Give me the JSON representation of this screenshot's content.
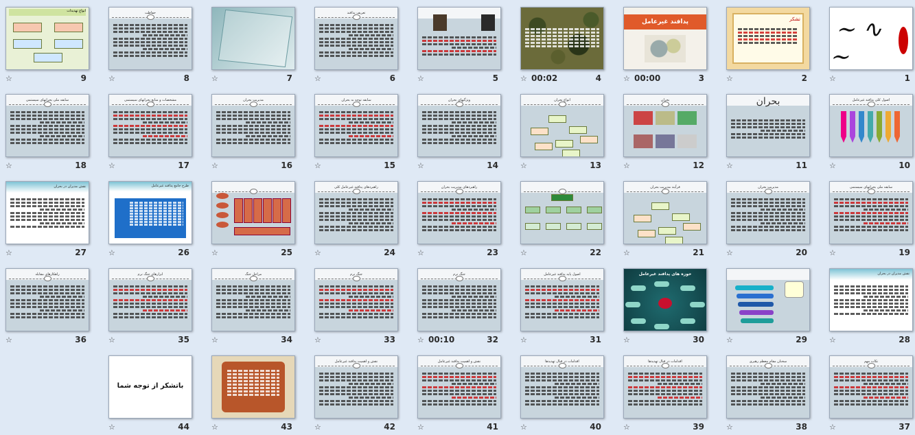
{
  "slides": [
    {
      "number": "1",
      "timing": "",
      "style": "calligraphy",
      "title": ""
    },
    {
      "number": "2",
      "timing": "",
      "style": "certificate",
      "title": "تشکر"
    },
    {
      "number": "3",
      "timing": "00:00",
      "style": "orange-title",
      "title": "پدافند غیرعامل"
    },
    {
      "number": "4",
      "timing": "00:02",
      "style": "camo",
      "title": ""
    },
    {
      "number": "5",
      "timing": "",
      "style": "portraits",
      "title": ""
    },
    {
      "number": "6",
      "timing": "",
      "style": "gray-text",
      "title": "تعریف پدافند"
    },
    {
      "number": "7",
      "timing": "",
      "style": "teal-glass",
      "title": ""
    },
    {
      "number": "8",
      "timing": "",
      "style": "gray-text",
      "title": "حفاظت"
    },
    {
      "number": "9",
      "timing": "",
      "style": "boxes",
      "title": "انواع تهدیدات"
    },
    {
      "number": "10",
      "timing": "",
      "style": "arrows",
      "title": "اصول کلی پدافند غیرعامل"
    },
    {
      "number": "11",
      "timing": "",
      "style": "bohran",
      "title": "بحران"
    },
    {
      "number": "12",
      "timing": "",
      "style": "photos",
      "title": "بحران"
    },
    {
      "number": "13",
      "timing": "",
      "style": "diagram",
      "title": "انواع بحران"
    },
    {
      "number": "14",
      "timing": "",
      "style": "gray-text",
      "title": "ویژگیهای بحران"
    },
    {
      "number": "15",
      "timing": "",
      "style": "gray-text",
      "title": "سابقه توجه به بحران"
    },
    {
      "number": "16",
      "timing": "",
      "style": "gray-text",
      "title": "مدیریت بحران"
    },
    {
      "number": "17",
      "timing": "",
      "style": "gray-text",
      "title": "مشخصات و منابع بحرانهای سیستمی"
    },
    {
      "number": "18",
      "timing": "",
      "style": "gray-text",
      "title": "سابقه ملی بحرانهای سیستمی"
    },
    {
      "number": "19",
      "timing": "",
      "style": "gray-text",
      "title": "سابقه ملی بحرانهای سیستمی"
    },
    {
      "number": "20",
      "timing": "",
      "style": "gray-text",
      "title": "مدیریت بحران"
    },
    {
      "number": "21",
      "timing": "",
      "style": "diagram",
      "title": "فرآیند مدیریت بحران"
    },
    {
      "number": "22",
      "timing": "",
      "style": "orgchart",
      "title": ""
    },
    {
      "number": "23",
      "timing": "",
      "style": "gray-text",
      "title": "راهبردهای مدیریت بحران"
    },
    {
      "number": "24",
      "timing": "",
      "style": "gray-text",
      "title": "راهبردهای پدافند غیرعامل کلی"
    },
    {
      "number": "25",
      "timing": "",
      "style": "flow",
      "title": ""
    },
    {
      "number": "26",
      "timing": "",
      "style": "blue-list",
      "title": "طرح جامع پدافند غیرعامل"
    },
    {
      "number": "27",
      "timing": "",
      "style": "white-list",
      "title": "نقش مدیران در بحران"
    },
    {
      "number": "28",
      "timing": "",
      "style": "white-list",
      "title": "نقش مدیران در بحران"
    },
    {
      "number": "29",
      "timing": "",
      "style": "bars",
      "title": ""
    },
    {
      "number": "30",
      "timing": "",
      "style": "mindmap",
      "title": "حوزه های پدافند غیرعامل"
    },
    {
      "number": "31",
      "timing": "",
      "style": "gray-text",
      "title": "اصول پایه پدافند غیرعامل"
    },
    {
      "number": "32",
      "timing": "00:10",
      "style": "gray-text",
      "title": "جنگ نرم"
    },
    {
      "number": "33",
      "timing": "",
      "style": "gray-text",
      "title": "جنگ نرم"
    },
    {
      "number": "34",
      "timing": "",
      "style": "gray-text",
      "title": "مراحل جنگ"
    },
    {
      "number": "35",
      "timing": "",
      "style": "gray-text",
      "title": "ابزارهای جنگ نرم"
    },
    {
      "number": "36",
      "timing": "",
      "style": "gray-text",
      "title": "راهکارهای مقابله"
    },
    {
      "number": "37",
      "timing": "",
      "style": "gray-text",
      "title": "نکات مهم"
    },
    {
      "number": "38",
      "timing": "",
      "style": "gray-text",
      "title": "سخنان مقام معظم رهبری"
    },
    {
      "number": "39",
      "timing": "",
      "style": "gray-text",
      "title": "اقدامات در قبال تهدیدها"
    },
    {
      "number": "40",
      "timing": "",
      "style": "gray-text",
      "title": "اقدامات در قبال تهدیدها"
    },
    {
      "number": "41",
      "timing": "",
      "style": "gray-text",
      "title": "نقش و اهمیت پدافند غیرعامل"
    },
    {
      "number": "42",
      "timing": "",
      "style": "gray-text",
      "title": "نقش و اهمیت پدافند غیرعامل"
    },
    {
      "number": "43",
      "timing": "",
      "style": "scroll",
      "title": ""
    },
    {
      "number": "44",
      "timing": "",
      "style": "thanks",
      "title": "باتشکر از توجه شما"
    }
  ]
}
